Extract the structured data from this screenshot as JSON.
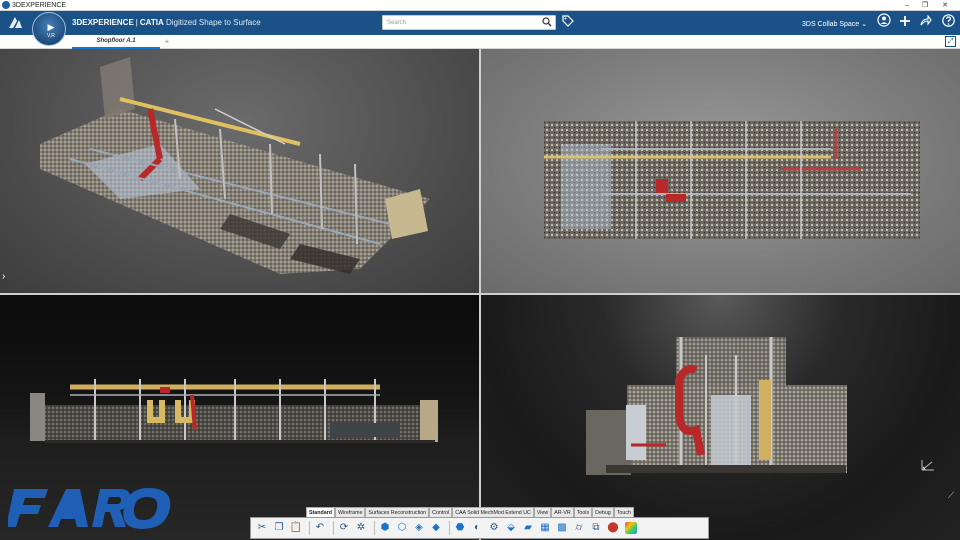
{
  "window": {
    "title": "3DEXPERIENCE",
    "min": "–",
    "max": "❐",
    "close": "✕"
  },
  "header": {
    "brand_bold": "3DEXPERIENCE",
    "separator": "|",
    "app_bold": "CATIA",
    "app_name": "Digitized Shape to Surface",
    "compass_v": "V,R",
    "search_placeholder": "Search",
    "collab_space": "3DS Collab Space ⌄"
  },
  "tabs": [
    {
      "label": "Shopfloor A.1"
    }
  ],
  "icons": {
    "ds_logo": "3ds-logo-icon",
    "search": "search-icon",
    "tag": "tag-icon",
    "user": "user-icon",
    "add": "plus-icon",
    "share": "share-icon",
    "help": "help-icon",
    "expand": "expand-icon"
  },
  "toolbar": {
    "tabs": [
      "Standard",
      "Wireframe",
      "Surfaces Reconstruction",
      "Control",
      "CAA Solid MechMod Extend UC",
      "View",
      "AR-VR",
      "Tools",
      "Debug",
      "Touch"
    ],
    "active_tab": "Standard"
  },
  "watermark": {
    "logo": "FARO"
  },
  "colors": {
    "header": "#1a5288",
    "accent": "#1a73c8",
    "faro": "#1f5fb6"
  }
}
